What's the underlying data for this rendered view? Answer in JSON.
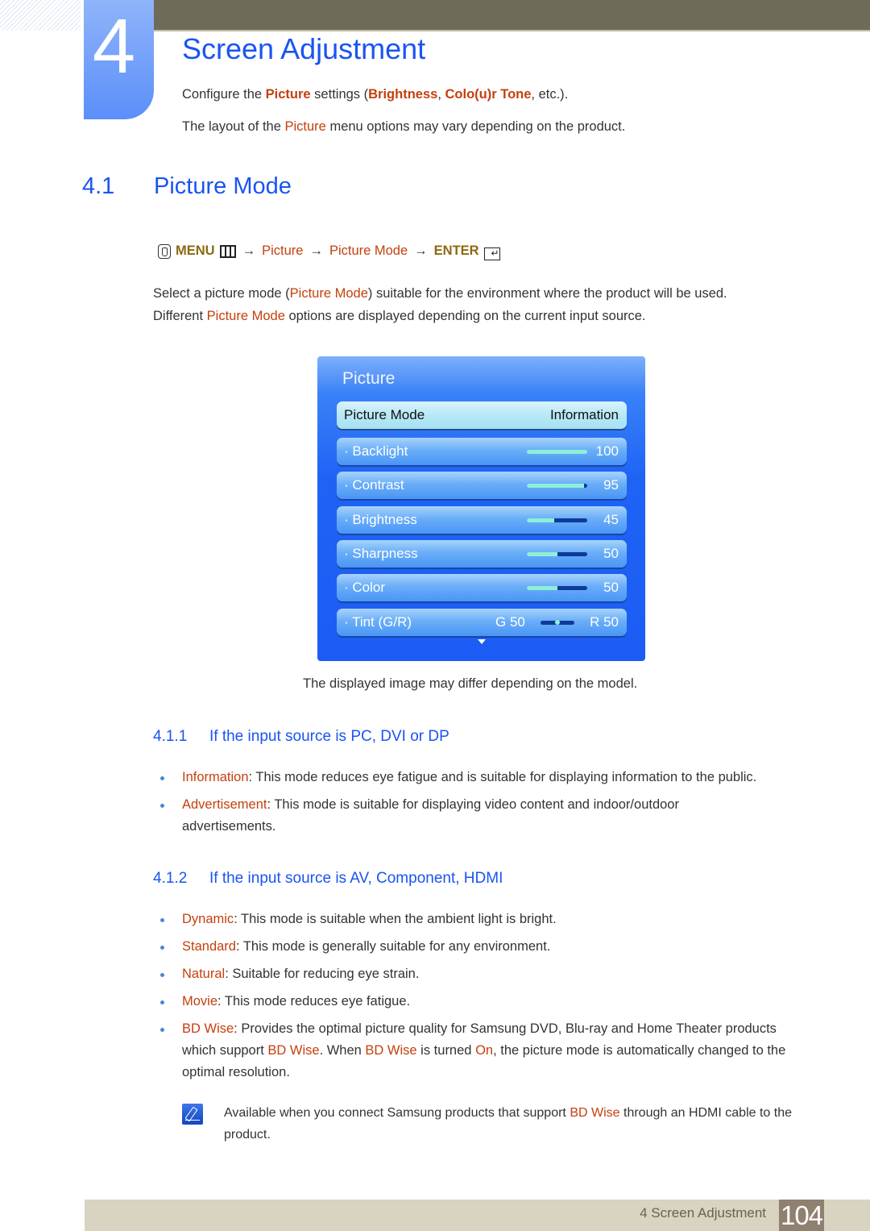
{
  "chapter": {
    "number": "4",
    "title": "Screen Adjustment",
    "intro_1": {
      "a": "Configure the ",
      "b": "Picture",
      "c": " settings (",
      "d": "Brightness",
      "e": ", ",
      "f": "Colo(u)r Tone",
      "g": ", etc.)."
    },
    "intro_2": {
      "a": "The layout of the ",
      "b": "Picture",
      "c": " menu options may vary depending on the product."
    }
  },
  "section": {
    "number": "4.1",
    "title": "Picture Mode",
    "menu_path": {
      "menu": "MENU",
      "arrow": "→",
      "steps": [
        "Picture",
        "Picture Mode"
      ],
      "enter": "ENTER"
    },
    "desc_1": {
      "a": "Select a picture mode (",
      "b": "Picture Mode",
      "c": ") suitable for the environment where the product will be used."
    },
    "desc_2": {
      "a": "Different ",
      "b": "Picture Mode",
      "c": " options are displayed depending on the current input source."
    }
  },
  "osd": {
    "title": "Picture",
    "selected_row": {
      "label": "Picture Mode",
      "value": "Information"
    },
    "rows": [
      {
        "label": "· Backlight",
        "value": "100",
        "level": 1.0
      },
      {
        "label": "· Contrast",
        "value": "95",
        "level": 0.95
      },
      {
        "label": "· Brightness",
        "value": "45",
        "level": 0.45
      },
      {
        "label": "· Sharpness",
        "value": "50",
        "level": 0.5
      },
      {
        "label": "· Color",
        "value": "50",
        "level": 0.5
      }
    ],
    "tint": {
      "label": "· Tint (G/R)",
      "g": "G 50",
      "r": "R 50",
      "balance": 0.5
    },
    "caption": "The displayed image may differ depending on the model."
  },
  "sub1": {
    "number": "4.1.1",
    "title": "If the input source is PC, DVI or DP",
    "items": [
      {
        "term": "Information",
        "text": ": This mode reduces eye fatigue and is suitable for displaying information to the public."
      },
      {
        "term": "Advertisement",
        "text": ": This mode is suitable for displaying video content and indoor/outdoor advertisements."
      }
    ]
  },
  "sub2": {
    "number": "4.1.2",
    "title": "If the input source is AV, Component, HDMI",
    "items": [
      {
        "term": "Dynamic",
        "text": ": This mode is suitable when the ambient light is bright."
      },
      {
        "term": "Standard",
        "text": ": This mode is generally suitable for any environment."
      },
      {
        "term": "Natural",
        "text": ": Suitable for reducing eye strain."
      },
      {
        "term": "Movie",
        "text": ": This mode reduces eye fatigue."
      }
    ],
    "bdwise": {
      "t1": "BD Wise",
      "s1": ": Provides the optimal picture quality for Samsung DVD, Blu-ray and Home Theater products which support ",
      "t2": "BD Wise",
      "s2": ". When ",
      "t3": "BD Wise",
      "s3": " is turned ",
      "t4": "On",
      "s4": ", the picture mode is automatically changed to the optimal resolution."
    },
    "note": {
      "a": "Available when you connect Samsung products that support ",
      "b": "BD Wise",
      "c": " through an HDMI cable to the product."
    }
  },
  "footer": {
    "label": "4 Screen Adjustment",
    "page": "104"
  }
}
